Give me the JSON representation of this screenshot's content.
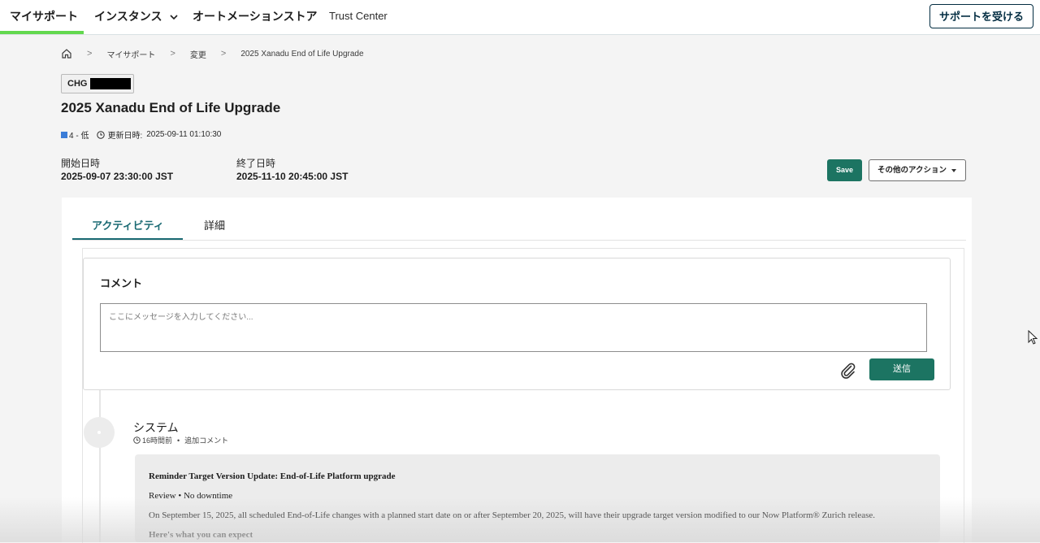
{
  "nav": {
    "items": [
      {
        "label": "マイサポート"
      },
      {
        "label": "インスタンス"
      },
      {
        "label": "オートメーションストア"
      },
      {
        "label": "Trust Center"
      }
    ],
    "support_button": "サポートを受ける",
    "active_color": "#62d84e"
  },
  "breadcrumb": {
    "items": [
      "マイサポート",
      "変更",
      "2025 Xanadu End of Life Upgrade"
    ]
  },
  "record": {
    "number_prefix": "CHG",
    "title": "2025 Xanadu End of Life Upgrade",
    "priority": "4 - 低",
    "updated_label": "更新日時:",
    "updated_value": "2025-09-11 01:10:30",
    "start_label": "開始日時",
    "start_value": "2025-09-07 23:30:00 JST",
    "end_label": "終了日時",
    "end_value": "2025-11-10 20:45:00 JST"
  },
  "actions": {
    "save": "Save",
    "more": "その他のアクション"
  },
  "tabs": [
    {
      "label": "アクティビティ",
      "active": true
    },
    {
      "label": "詳細",
      "active": false
    }
  ],
  "comment": {
    "title": "コメント",
    "placeholder": "ここにメッセージを入力してください...",
    "send": "送信"
  },
  "activity": {
    "author": "システム",
    "time": "16時間前",
    "type": "追加コメント",
    "body": [
      "Reminder Target Version Update: End-of-Life Platform upgrade",
      "Review • No downtime",
      "On September 15, 2025, all scheduled End-of-Life changes with a planned start date on or after September 20, 2025, will have their upgrade target version modified to our Now Platform® Zurich release.",
      "Here's what you can expect"
    ]
  },
  "colors": {
    "primary_button": "#1c7462",
    "tab_active": "#1a6a73",
    "priority_low": "#3b7dd8"
  }
}
